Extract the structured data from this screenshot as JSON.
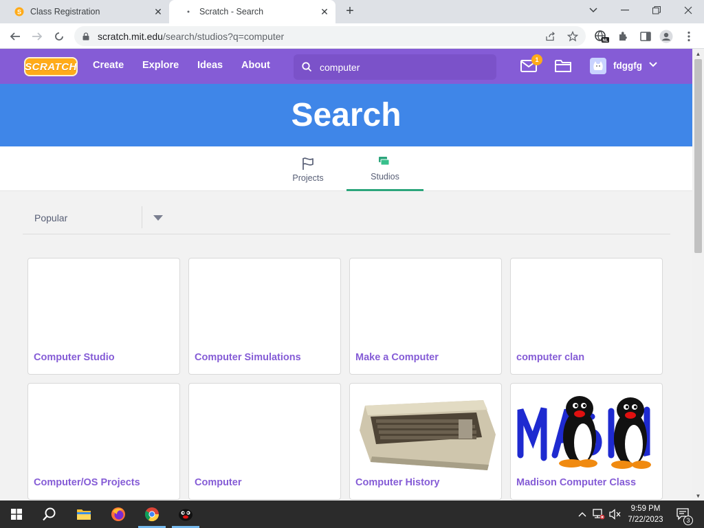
{
  "browser": {
    "tabs": [
      {
        "title": "Class Registration",
        "active": false
      },
      {
        "title": "Scratch - Search",
        "active": true
      }
    ],
    "url_host": "scratch.mit.edu",
    "url_path": "/search/studios?q=computer"
  },
  "site": {
    "logo_text": "SCRATCH",
    "nav": {
      "create": "Create",
      "explore": "Explore",
      "ideas": "Ideas",
      "about": "About"
    },
    "search_value": "computer",
    "messages_count": "1",
    "username": "fdggfg",
    "accent": "#855cd6",
    "banner_color": "#3f86e8"
  },
  "banner": {
    "title": "Search"
  },
  "search_tabs": {
    "projects": "Projects",
    "studios": "Studios",
    "active": "Studios"
  },
  "sort": {
    "selected": "Popular"
  },
  "results": [
    {
      "title": "Computer Studio",
      "thumbnail": "blank"
    },
    {
      "title": "Computer Simulations",
      "thumbnail": "blank"
    },
    {
      "title": "Make a Computer",
      "thumbnail": "blank"
    },
    {
      "title": "computer clan",
      "thumbnail": "blank"
    },
    {
      "title": "Computer/OS Projects",
      "thumbnail": "blank"
    },
    {
      "title": "Computer",
      "thumbnail": "blank"
    },
    {
      "title": "Computer History",
      "thumbnail": "keyboard-computer-image"
    },
    {
      "title": "Madison Computer Class",
      "thumbnail": "penguins-madison-image"
    }
  ],
  "taskbar": {
    "time": "9:59 PM",
    "date": "7/22/2023",
    "notifications": "3"
  }
}
